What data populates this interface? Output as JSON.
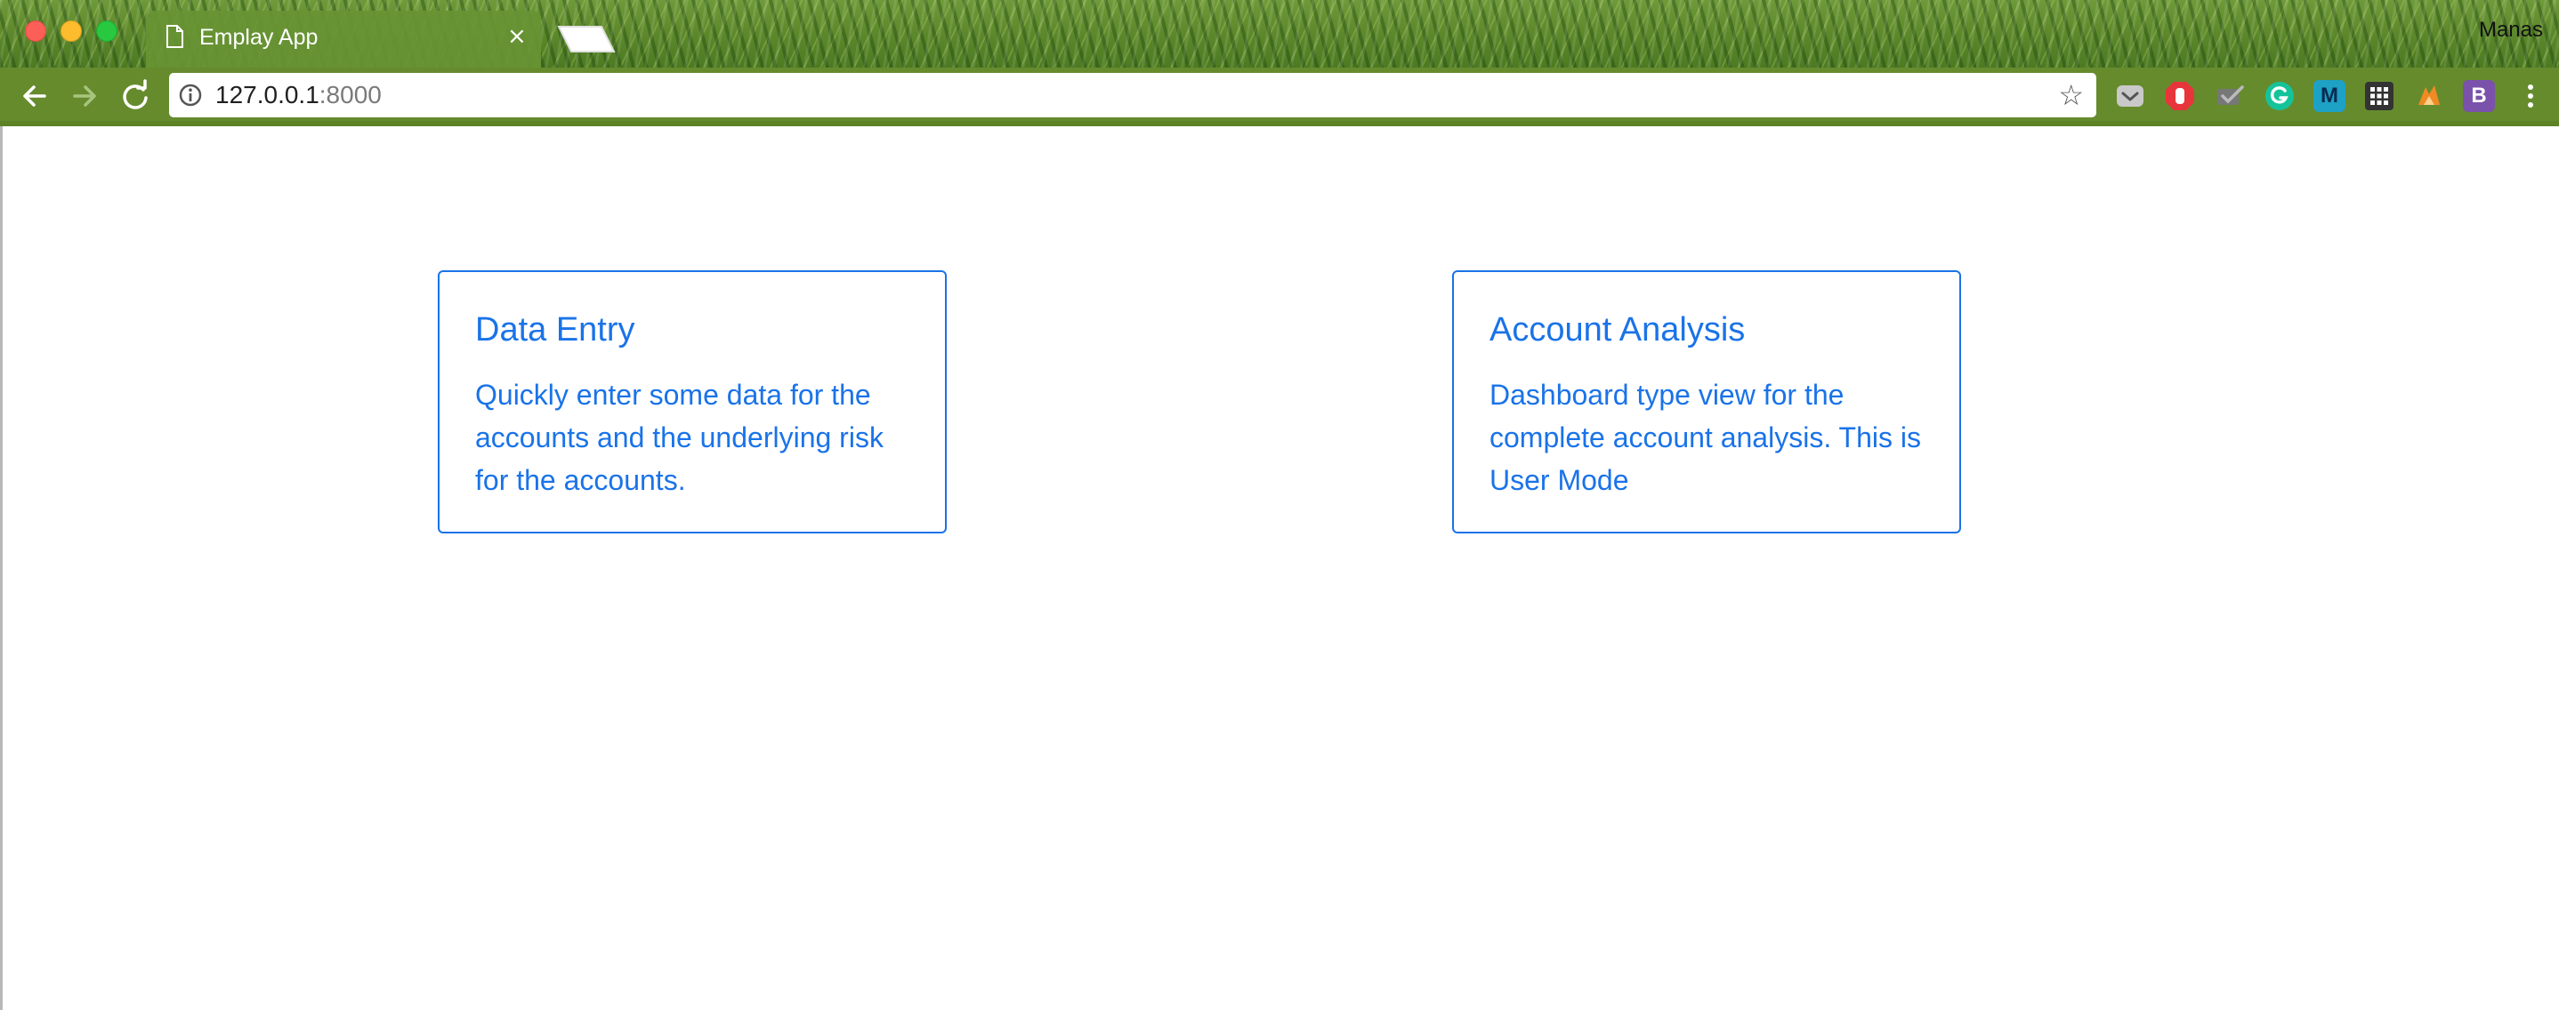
{
  "browser": {
    "tab": {
      "title": "Emplay App",
      "close": "×"
    },
    "profile_name": "Manas",
    "address": {
      "host": "127.0.0.1",
      "port": ":8000"
    }
  },
  "extensions": [
    {
      "name": "pocket-icon"
    },
    {
      "name": "adblock-icon"
    },
    {
      "name": "checkmark-icon"
    },
    {
      "name": "grammarly-icon"
    },
    {
      "name": "m-icon",
      "label": "M"
    },
    {
      "name": "apps-grid-icon"
    },
    {
      "name": "fox-icon"
    },
    {
      "name": "bootstrap-icon",
      "label": "B"
    }
  ],
  "colors": {
    "accent": "#1a73e8",
    "toolbar": "#668b2d"
  },
  "cards": [
    {
      "title": "Data Entry",
      "text": "Quickly enter some data for the accounts and the underlying risk for the accounts."
    },
    {
      "title": "Account Analysis",
      "text": "Dashboard type view for the complete account analysis. This is User Mode"
    }
  ]
}
